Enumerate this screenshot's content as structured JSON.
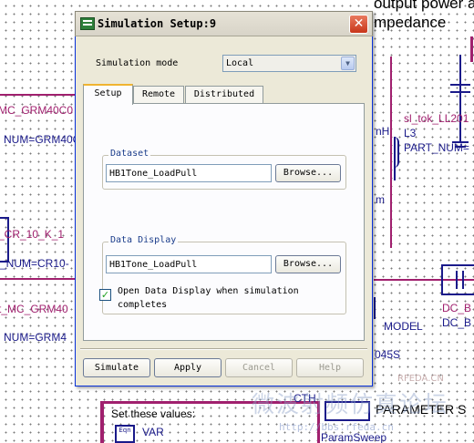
{
  "dialog": {
    "title": "Simulation Setup:9",
    "close_glyph": "✕",
    "simulation_mode_label": "Simulation mode",
    "simulation_mode_value": "Local",
    "tabs": [
      "Setup",
      "Remote",
      "Distributed"
    ],
    "dataset": {
      "legend": "Dataset",
      "value": "HB1Tone_LoadPull",
      "browse": "Browse..."
    },
    "data_display": {
      "legend": "Data Display",
      "value": "HB1Tone_LoadPull",
      "browse": "Browse...",
      "open_checkbox_line1": "Open Data Display when simulation",
      "open_checkbox_line2": "completes",
      "open_checked": true
    },
    "buttons": {
      "simulate": "Simulate",
      "apply": "Apply",
      "cancel": "Cancel",
      "help": "Help"
    }
  },
  "schematic": {
    "title_line1": "output power and PAE found at",
    "title_line2": "mpedance",
    "labels": [
      "MC_GRM40C0",
      "NUM=GRM40C0",
      "_CR_10_K_1",
      "_NUM=CR10-",
      "t_MC_GRM40",
      "NUM=GRM4",
      "sl_tok_LL201",
      "nH",
      "L3",
      "PART_NUM=",
      "m",
      "MODEL",
      "045S",
      "DC_B",
      "DC_B",
      "CTH",
      "Set these values:",
      "VAR",
      "PARAMETER S",
      "ParamSweep"
    ],
    "var_icon_text": "Eqn"
  },
  "watermark": {
    "chinese": "微波射频仿真论坛",
    "url": "http://bbs.rfeda.cn",
    "site": "RFEDA.CN"
  }
}
